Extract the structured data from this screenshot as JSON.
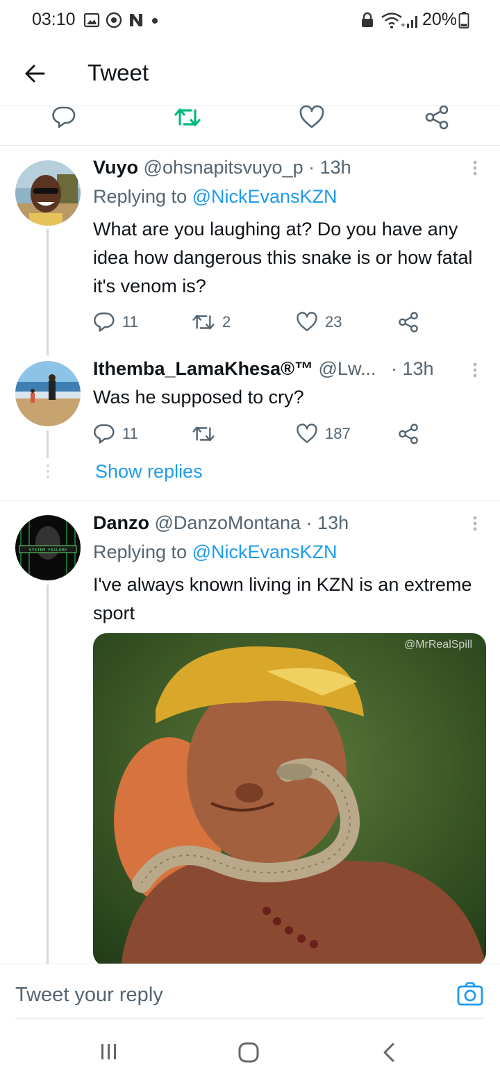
{
  "status_bar": {
    "time": "03:10",
    "battery": "20%",
    "icons": [
      "gallery-icon",
      "chrome-icon",
      "n-icon",
      "dot-icon",
      "lock-icon",
      "wifi-icon",
      "signal-icon",
      "battery-icon"
    ]
  },
  "header": {
    "title": "Tweet",
    "back_icon": "arrow-left-icon"
  },
  "top_actions": [
    "reply-icon",
    "retweet-icon",
    "like-icon",
    "share-icon"
  ],
  "tweets": [
    {
      "name": "Vuyo",
      "handle": "@ohsnapitsvuyo_p",
      "time": "· 13h",
      "replying_prefix": "Replying to",
      "replying_handle": "@NickEvansKZN",
      "text": "What are you laughing at? Do you have any idea how dangerous this snake is or how fatal it's venom is?",
      "replies": "11",
      "retweets": "2",
      "likes": "23"
    },
    {
      "name": "Ithemba_LamaKhesa®™",
      "handle": "@Lw...",
      "time": "· 13h",
      "text": "Was he supposed to cry?",
      "replies": "11",
      "retweets": "",
      "likes": "187",
      "show_replies": "Show replies"
    },
    {
      "name": "Danzo",
      "handle": "@DanzoMontana",
      "time": "· 13h",
      "replying_prefix": "Replying to",
      "replying_handle": "@NickEvansKZN",
      "text": "I've always known living in KZN is an extreme sport",
      "media_watermark": "@MrRealSpill",
      "avatar_text": "SYSTEM FAILURE"
    }
  ],
  "reply_bar": {
    "placeholder": "Tweet your reply",
    "camera_icon": "camera-icon"
  },
  "colors": {
    "accent": "#1d9bf0",
    "retweet_active": "#00ba7c",
    "secondary_text": "#536471",
    "divider": "#e6ecf0"
  }
}
